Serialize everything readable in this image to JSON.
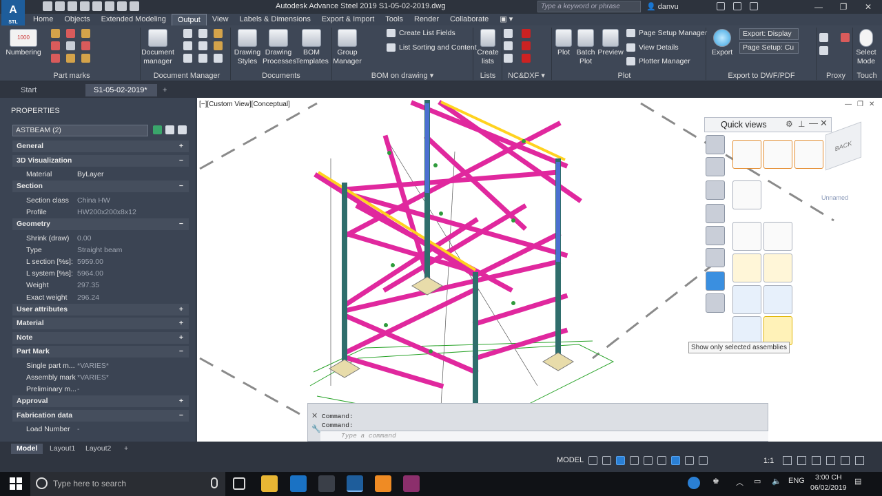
{
  "window": {
    "title": "Autodesk Advance Steel 2019    S1-05-02-2019.dwg",
    "logo": "A",
    "logo_sub": "STL"
  },
  "search": {
    "placeholder": "Type a keyword or phrase"
  },
  "user": {
    "name": "danvu"
  },
  "menu": {
    "tabs": [
      "Home",
      "Objects",
      "Extended Modeling",
      "Output",
      "View",
      "Labels & Dimensions",
      "Export & Import",
      "Tools",
      "Render",
      "Collaborate"
    ],
    "active": "Output"
  },
  "ribbon": {
    "numbering": "Numbering",
    "numbering_value": "1000",
    "document_manager": "Document manager",
    "drawing_styles": "Drawing Styles",
    "drawing_processes": "Drawing Processes",
    "bom_templates": "BOM Templates",
    "group_manager": "Group Manager",
    "create_list_fields": "Create List Fields",
    "list_sorting": "List Sorting and Content",
    "create_lists": "Create lists",
    "plot": "Plot",
    "batch_plot": "Batch Plot",
    "preview": "Preview",
    "page_setup_manager": "Page Setup Manager",
    "view_details": "View Details",
    "plotter_manager": "Plotter Manager",
    "export": "Export",
    "export_display": "Export: Display",
    "page_setup": "Page Setup: Cu",
    "select_mode": "Select Mode",
    "groups": {
      "part_marks": "Part marks",
      "document_manager": "Document Manager",
      "documents": "Documents",
      "bom_on_drawing": "BOM on drawing",
      "lists": "Lists",
      "nc_dxf": "NC&DXF",
      "plot": "Plot",
      "export_dwf": "Export to DWF/PDF",
      "proxy": "Proxy",
      "touch": "Touch"
    }
  },
  "doc_tabs": {
    "start": "Start",
    "active": "S1-05-02-2019*",
    "add": "+"
  },
  "properties": {
    "title": "PROPERTIES",
    "selection": "ASTBEAM (2)",
    "rows": [
      {
        "type": "cat",
        "label": "General",
        "sign": "+"
      },
      {
        "type": "cat",
        "label": "3D Visualization",
        "sign": "−"
      },
      {
        "type": "prop",
        "key": "Material",
        "value": "ByLayer",
        "dim": false
      },
      {
        "type": "cat",
        "label": "Section",
        "sign": "−"
      },
      {
        "type": "prop",
        "key": "Section class",
        "value": "China HW",
        "dim": true
      },
      {
        "type": "prop",
        "key": "Profile",
        "value": "HW200x200x8x12",
        "dim": true
      },
      {
        "type": "cat",
        "label": "Geometry",
        "sign": "−"
      },
      {
        "type": "prop",
        "key": "Shrink (draw)",
        "value": "0.00",
        "dim": true
      },
      {
        "type": "prop",
        "key": "Type",
        "value": "Straight beam",
        "dim": true
      },
      {
        "type": "prop",
        "key": "L section [%s]:",
        "value": "5959.00",
        "dim": true
      },
      {
        "type": "prop",
        "key": "L system [%s]:",
        "value": "5964.00",
        "dim": true
      },
      {
        "type": "prop",
        "key": "Weight",
        "value": "297.35",
        "dim": true
      },
      {
        "type": "prop",
        "key": "Exact weight",
        "value": "296.24",
        "dim": true
      },
      {
        "type": "cat",
        "label": "User attributes",
        "sign": "+"
      },
      {
        "type": "cat",
        "label": "Material",
        "sign": "+"
      },
      {
        "type": "cat",
        "label": "Note",
        "sign": "+"
      },
      {
        "type": "cat",
        "label": "Part Mark",
        "sign": "−"
      },
      {
        "type": "prop",
        "key": "Single part m...",
        "value": "*VARIES*",
        "dim": true
      },
      {
        "type": "prop",
        "key": "Assembly mark",
        "value": "*VARIES*",
        "dim": true
      },
      {
        "type": "prop",
        "key": "Preliminary m...",
        "value": "-",
        "dim": true
      },
      {
        "type": "cat",
        "label": "Approval",
        "sign": "+"
      },
      {
        "type": "cat",
        "label": "Fabrication data",
        "sign": "−"
      },
      {
        "type": "prop",
        "key": "Load Number",
        "value": "-",
        "dim": true
      }
    ]
  },
  "viewport": {
    "label": "[−][Custom View][Conceptual]",
    "viewcube_label": "BACK",
    "named_view": "Unnamed"
  },
  "quick_views": {
    "title": "Quick views",
    "tooltip": "Show only selected assemblies"
  },
  "command": {
    "line1": "Command:",
    "line2": "Command:",
    "placeholder": "Type a command"
  },
  "layout_tabs": {
    "model": "Model",
    "layout1": "Layout1",
    "layout2": "Layout2",
    "add": "+"
  },
  "status": {
    "model": "MODEL",
    "scale": "1:1"
  },
  "taskbar": {
    "search": "Type here to search",
    "lang": "ENG",
    "time": "3:00 CH",
    "date": "06/02/2019"
  },
  "colors": {
    "beam_magenta": "#e0289e",
    "column_teal": "#2f6e6c",
    "ribbon_bg": "#3e4756",
    "accent_blue": "#2a7fd4"
  }
}
